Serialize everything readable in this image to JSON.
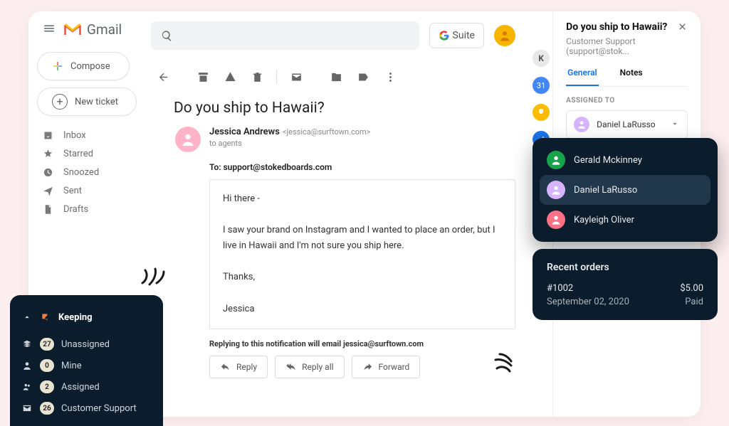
{
  "header": {
    "app_name": "Gmail",
    "gsuite_label": "Suite"
  },
  "compose_label": "Compose",
  "newticket_label": "New ticket",
  "nav": {
    "inbox": "Inbox",
    "starred": "Starred",
    "snoozed": "Snoozed",
    "sent": "Sent",
    "drafts": "Drafts"
  },
  "subject": "Do you ship to Hawaii?",
  "sender": {
    "name": "Jessica Andrews",
    "addr": "<jessica@surftown.com>",
    "recipients": "to agents"
  },
  "to_line": "To: support@stokedboards.com",
  "body_greeting": "Hi there -",
  "body_main": "I saw your brand on Instagram and I wanted to place an order, but I live in Hawaii and I'm not sure you ship here.",
  "body_thanks": "Thanks,",
  "body_signoff": "Jessica",
  "reply_note": "Replying to this notification will email jessica@surftown.com",
  "reply_btns": {
    "reply": "Reply",
    "replyall": "Reply all",
    "forward": "Forward"
  },
  "panel": {
    "title": "Do you ship to Hawaii?",
    "subtitle": "Customer Support (support@stok...",
    "tab_general": "General",
    "tab_notes": "Notes",
    "assigned_hdr": "ASSIGNED TO",
    "assignee": "Daniel LaRusso"
  },
  "people": {
    "p1": "Gerald Mckinney",
    "p2": "Daniel LaRusso",
    "p3": "Kayleigh Oliver"
  },
  "orders": {
    "title": "Recent orders",
    "id": "#1002",
    "amount": "$5.00",
    "date": "September 02, 2020",
    "status": "Paid"
  },
  "keeping": {
    "title": "Keeping",
    "unassigned_label": "Unassigned",
    "unassigned_count": "27",
    "mine_label": "Mine",
    "mine_count": "0",
    "assigned_label": "Assigned",
    "assigned_count": "2",
    "cs_label": "Customer Support",
    "cs_count": "26"
  }
}
